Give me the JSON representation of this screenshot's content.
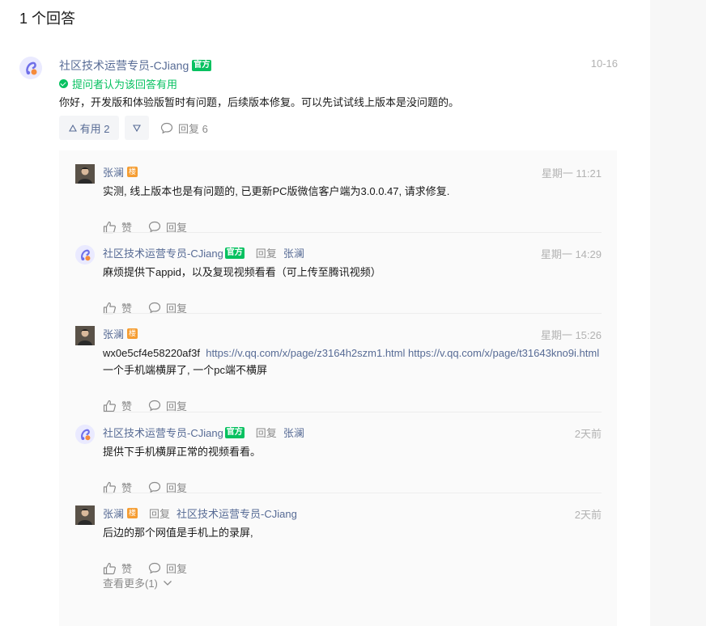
{
  "page": {
    "heading": "1 个回答"
  },
  "answer": {
    "author": "社区技术运营专员-CJiang",
    "badge": "官方",
    "time": "10-16",
    "accepted": "提问者认为该回答有用",
    "content": "你好，开发版和体验版暂时有问题，后续版本修复。可以先试试线上版本是没问题的。",
    "upvote_label": "有用 2",
    "reply_count": "回复 6"
  },
  "labels": {
    "like": "赞",
    "reply": "回复",
    "reply_to": "回复",
    "floor_badge": "楼",
    "official_badge": "官方"
  },
  "comments": [
    {
      "author": "张澜",
      "time": "星期一 11:21",
      "text": "实测, 线上版本也是有问题的, 已更新PC版微信客户端为3.0.0.47, 请求修复."
    },
    {
      "author": "社区技术运营专员-CJiang",
      "reply_to": "张澜",
      "time": "星期一 14:29",
      "text": "麻烦提供下appid，以及复现视频看看（可上传至腾讯视频）"
    },
    {
      "author": "张澜",
      "time": "星期一 15:26",
      "text_prefix": "wx0e5cf4e58220af3f",
      "link1": "https://v.qq.com/x/page/z3164h2szm1.html",
      "link2": "https://v.qq.com/x/page/t31643kno9i.html",
      "text_suffix": " 一个手机端横屏了, 一个pc端不横屏"
    },
    {
      "author": "社区技术运营专员-CJiang",
      "reply_to": "张澜",
      "time": "2天前",
      "text": "提供下手机横屏正常的视频看看。"
    },
    {
      "author": "张澜",
      "reply_to": "社区技术运营专员-CJiang",
      "time": "2天前",
      "text": "后边的那个网值是手机上的录屏,"
    }
  ],
  "more": "查看更多(1)",
  "colors": {
    "link": "#576b95",
    "green": "#07c160",
    "orange": "#f59d32",
    "muted": "#8a8a8a"
  }
}
